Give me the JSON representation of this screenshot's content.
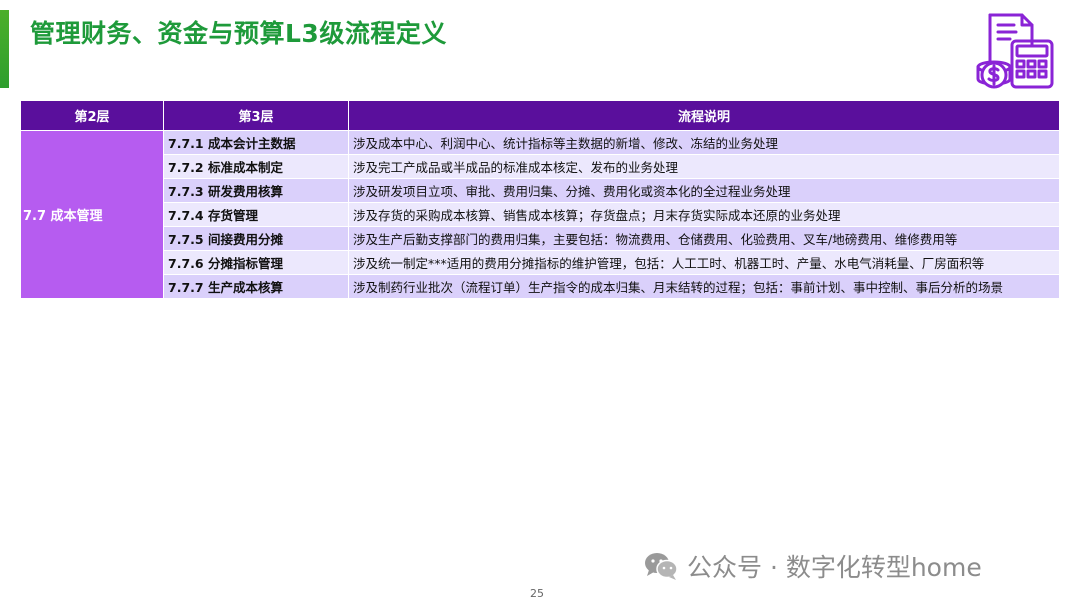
{
  "slide": {
    "title": "管理财务、资金与预算L3级流程定义",
    "logo_icon": "finance-calculator-icon",
    "page_number": "25",
    "watermark": "公众号 · 数字化转型home",
    "watermark_icon": "wechat-icon"
  },
  "table": {
    "headers": [
      "第2层",
      "第3层",
      "流程说明"
    ],
    "level2": "7.7 成本管理",
    "rows": [
      {
        "code": "7.7.1  成本会计主数据",
        "desc": "涉及成本中心、利润中心、统计指标等主数据的新增、修改、冻结的业务处理"
      },
      {
        "code": "7.7.2  标准成本制定",
        "desc": "涉及完工产成品或半成品的标准成本核定、发布的业务处理"
      },
      {
        "code": "7.7.3  研发费用核算",
        "desc": "涉及研发项目立项、审批、费用归集、分摊、费用化或资本化的全过程业务处理"
      },
      {
        "code": "7.7.4  存货管理",
        "desc": "涉及存货的采购成本核算、销售成本核算；存货盘点；月末存货实际成本还原的业务处理"
      },
      {
        "code": "7.7.5  间接费用分摊",
        "desc": "涉及生产后勤支撑部门的费用归集，主要包括：物流费用、仓储费用、化验费用、叉车/地磅费用、维修费用等"
      },
      {
        "code": "7.7.6  分摊指标管理",
        "desc": "涉及统一制定***适用的费用分摊指标的维护管理，包括：人工工时、机器工时、产量、水电气消耗量、厂房面积等"
      },
      {
        "code": "7.7.7  生产成本核算",
        "desc": "涉及制药行业批次（流程订单）生产指令的成本归集、月末结转的过程；包括：事前计划、事中控制、事后分析的场景"
      }
    ]
  },
  "colors": {
    "title": "#1e9a3a",
    "header_bg": "#5a0f9c",
    "level2_bg": "#b65cf0",
    "row_odd": "#dad0fb",
    "row_even": "#ece8fd",
    "icon": "#8a24d6"
  }
}
